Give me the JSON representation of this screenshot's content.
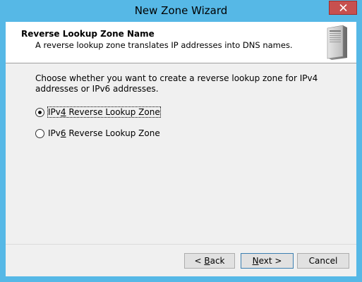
{
  "window": {
    "title": "New Zone Wizard"
  },
  "header": {
    "title": "Reverse Lookup Zone Name",
    "description": "A reverse lookup zone translates IP addresses into DNS names."
  },
  "body": {
    "prompt": "Choose whether you want to create a reverse lookup zone for IPv4 addresses or IPv6 addresses.",
    "options": [
      {
        "pre": "IPv",
        "accel": "4",
        "post": " Reverse Lookup Zone",
        "checked": true
      },
      {
        "pre": "IPv",
        "accel": "6",
        "post": " Reverse Lookup Zone",
        "checked": false
      }
    ]
  },
  "buttons": {
    "back": {
      "pre": "< ",
      "accel": "B",
      "post": "ack"
    },
    "next": {
      "pre": "",
      "accel": "N",
      "post": "ext >"
    },
    "cancel": "Cancel"
  },
  "colors": {
    "titlebar": "#56b8e6",
    "close": "#c7504f"
  },
  "icons": {
    "close": "close-icon",
    "server": "server-icon"
  }
}
